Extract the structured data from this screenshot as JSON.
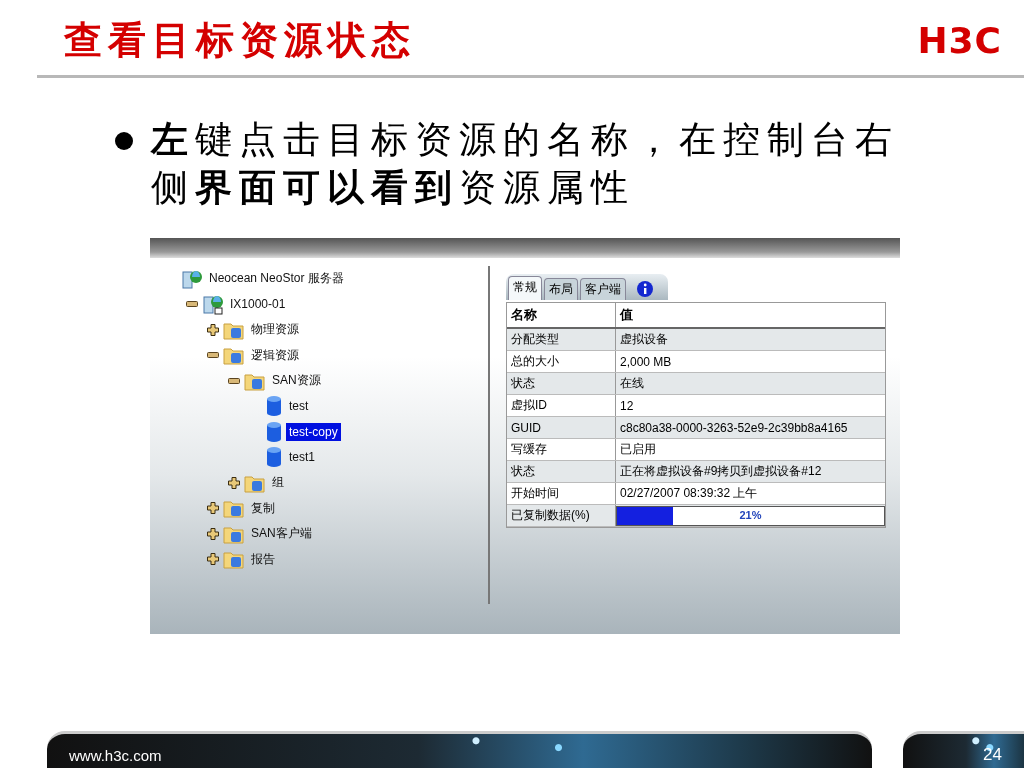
{
  "header": {
    "title": "查看目标资源状态",
    "logo": "H3C"
  },
  "bullet": {
    "text": "**左**键点击目标资源的名称，在控制台右侧**界面可以看到**资源属性"
  },
  "console": {
    "tree": [
      {
        "label": "Neocean NeoStor 服务器",
        "kind": "server",
        "selected": false,
        "children": [
          {
            "label": "IX1000-01",
            "kind": "host",
            "expanded": true,
            "selected": false,
            "children": [
              {
                "label": "物理资源",
                "kind": "folder",
                "expanded": false,
                "selected": false
              },
              {
                "label": "逻辑资源",
                "kind": "folder",
                "expanded": true,
                "selected": false,
                "children": [
                  {
                    "label": "SAN资源",
                    "kind": "folder",
                    "expanded": true,
                    "selected": false,
                    "children": [
                      {
                        "label": "test",
                        "kind": "disk",
                        "selected": false
                      },
                      {
                        "label": "test-copy",
                        "kind": "disk",
                        "selected": true
                      },
                      {
                        "label": "test1",
                        "kind": "disk",
                        "selected": false
                      }
                    ]
                  },
                  {
                    "label": "组",
                    "kind": "folder",
                    "expanded": false,
                    "selected": false
                  }
                ]
              },
              {
                "label": "复制",
                "kind": "folder",
                "expanded": false,
                "selected": false
              },
              {
                "label": "SAN客户端",
                "kind": "folder",
                "expanded": false,
                "selected": false
              },
              {
                "label": "报告",
                "kind": "folder",
                "expanded": false,
                "selected": false
              }
            ]
          }
        ]
      }
    ],
    "tabs": [
      {
        "label": "常规",
        "selected": true
      },
      {
        "label": "布局",
        "selected": false
      },
      {
        "label": "客户端",
        "selected": false
      }
    ],
    "table": {
      "columns": [
        "名称",
        "值"
      ],
      "rows": [
        {
          "name": "分配类型",
          "value": "虚拟设备"
        },
        {
          "name": "总的大小",
          "value": "2,000 MB"
        },
        {
          "name": "状态",
          "value": "在线"
        },
        {
          "name": "虚拟ID",
          "value": "12"
        },
        {
          "name": "GUID",
          "value": "c8c80a38-0000-3263-52e9-2c39bb8a4165"
        },
        {
          "name": "写缓存",
          "value": "已启用"
        },
        {
          "name": "状态",
          "value": "正在将虚拟设备#9拷贝到虚拟设备#12"
        },
        {
          "name": "开始时间",
          "value": "02/27/2007 08:39:32 上午"
        },
        {
          "name": "已复制数据(%)",
          "kind": "progress",
          "level": 0.21,
          "reading": "21%"
        }
      ]
    }
  },
  "footer": {
    "url": "www.h3c.com",
    "page": "24"
  }
}
